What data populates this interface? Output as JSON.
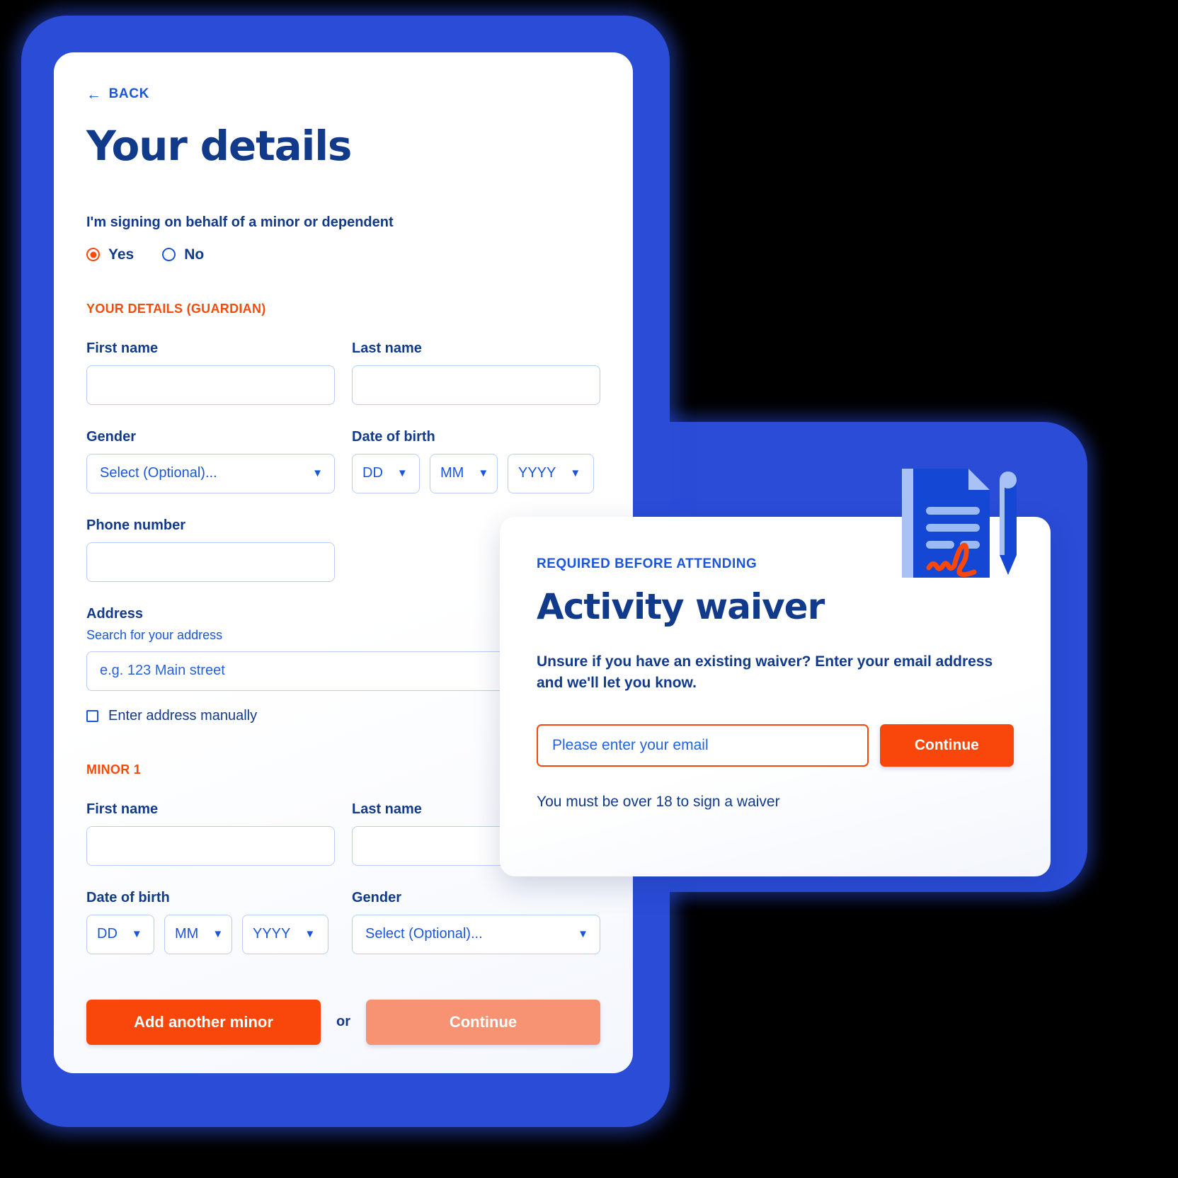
{
  "phone": {
    "back_label": "BACK",
    "back_icon": "arrow-left-icon",
    "page_title": "Your details",
    "minor_question": {
      "label": "I'm signing on behalf of a minor or dependent",
      "options": [
        {
          "label": "Yes",
          "selected": true
        },
        {
          "label": "No",
          "selected": false
        }
      ]
    },
    "guardian_section": {
      "heading": "YOUR DETAILS (GUARDIAN)",
      "first_name_label": "First name",
      "first_name_value": "",
      "last_name_label": "Last name",
      "last_name_value": "",
      "gender_label": "Gender",
      "gender_value": "Select (Optional)...",
      "dob_label": "Date of birth",
      "dob_day": "DD",
      "dob_month": "MM",
      "dob_year": "YYYY",
      "phone_label": "Phone number",
      "phone_value": "",
      "address_label": "Address",
      "address_sub_label": "Search for your address",
      "address_placeholder": "e.g. 123 Main street",
      "manual_address_label": "Enter address manually",
      "manual_address_checked": false
    },
    "minor_section": {
      "heading": "MINOR 1",
      "first_name_label": "First name",
      "first_name_value": "",
      "last_name_label": "Last name",
      "last_name_value": "",
      "dob_label": "Date of birth",
      "dob_day": "DD",
      "dob_month": "MM",
      "dob_year": "YYYY",
      "gender_label": "Gender",
      "gender_value": "Select (Optional)..."
    },
    "actions": {
      "add_minor_label": "Add another minor",
      "or_label": "or",
      "continue_label": "Continue"
    }
  },
  "waiver": {
    "eyebrow": "REQUIRED BEFORE ATTENDING",
    "title": "Activity waiver",
    "subtitle": "Unsure if you have an existing waiver? Enter your email address and we'll let you know.",
    "email_placeholder": "Please enter your email",
    "email_value": "",
    "continue_label": "Continue",
    "note": "You must be over 18 to sign a waiver",
    "icon": "document-signature-pen-icon"
  },
  "colors": {
    "frame_blue": "#2A4CD7",
    "deep_blue": "#123A8A",
    "link_blue": "#1A56DB",
    "accent_orange": "#F9470B",
    "muted_orange": "#F79272",
    "input_border": "#B9CEF6"
  }
}
